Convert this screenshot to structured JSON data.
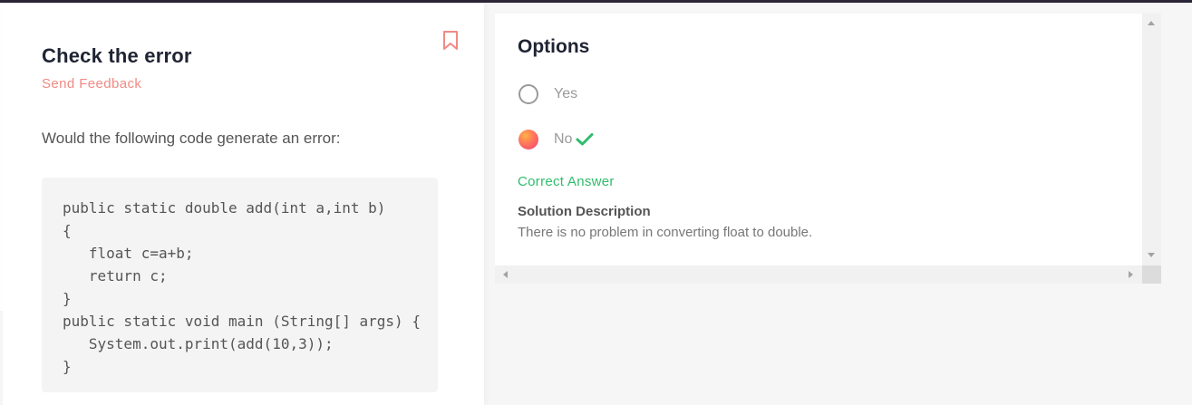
{
  "question": {
    "title": "Check the error",
    "feedback_label": "Send Feedback",
    "prompt": "Would the following code generate an error:",
    "code_lines": [
      "public static double add(int a,int b)",
      "{",
      "   float c=a+b;",
      "   return c;",
      "}",
      "public static void main (String[] args) {",
      "   System.out.print(add(10,3));",
      "}"
    ]
  },
  "options": {
    "title": "Options",
    "items": [
      {
        "label": "Yes",
        "selected": false
      },
      {
        "label": "No",
        "selected": true,
        "correct": true
      }
    ]
  },
  "result": {
    "correct_label": "Correct Answer",
    "solution_title": "Solution Description",
    "solution_text": "There is no problem in converting float to double."
  },
  "icons": {
    "bookmark": "bookmark-icon",
    "check": "check-icon"
  },
  "colors": {
    "accent": "#f08a84",
    "success": "#2fbd6b",
    "title": "#1f2433"
  }
}
